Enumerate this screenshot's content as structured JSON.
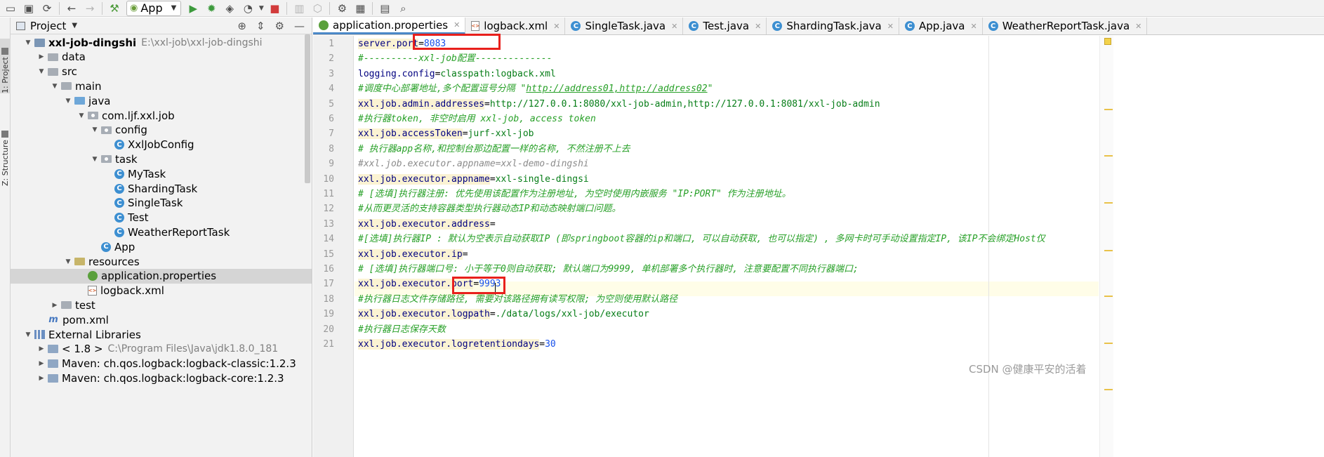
{
  "toolbar": {
    "run_config": "App"
  },
  "side_tabs": {
    "project": "1: Project",
    "structure": "Z: Structure"
  },
  "project_panel": {
    "title": "Project"
  },
  "tree": [
    {
      "label": "xxl-job-dingshi",
      "extra": "E:\\xxl-job\\xxl-job-dingshi",
      "depth": 0,
      "arrow": "open",
      "icon": "module"
    },
    {
      "label": "data",
      "depth": 1,
      "arrow": "closed",
      "icon": "folder"
    },
    {
      "label": "src",
      "depth": 1,
      "arrow": "open",
      "icon": "folder"
    },
    {
      "label": "main",
      "depth": 2,
      "arrow": "open",
      "icon": "folder"
    },
    {
      "label": "java",
      "depth": 3,
      "arrow": "open",
      "icon": "folder-blue"
    },
    {
      "label": "com.ljf.xxl.job",
      "depth": 4,
      "arrow": "open",
      "icon": "package"
    },
    {
      "label": "config",
      "depth": 5,
      "arrow": "open",
      "icon": "package"
    },
    {
      "label": "XxlJobConfig",
      "depth": 6,
      "arrow": "none",
      "icon": "class"
    },
    {
      "label": "task",
      "depth": 5,
      "arrow": "open",
      "icon": "package"
    },
    {
      "label": "MyTask",
      "depth": 6,
      "arrow": "none",
      "icon": "class"
    },
    {
      "label": "ShardingTask",
      "depth": 6,
      "arrow": "none",
      "icon": "class"
    },
    {
      "label": "SingleTask",
      "depth": 6,
      "arrow": "none",
      "icon": "class"
    },
    {
      "label": "Test",
      "depth": 6,
      "arrow": "none",
      "icon": "class"
    },
    {
      "label": "WeatherReportTask",
      "depth": 6,
      "arrow": "none",
      "icon": "class"
    },
    {
      "label": "App",
      "depth": 5,
      "arrow": "none",
      "icon": "class"
    },
    {
      "label": "resources",
      "depth": 3,
      "arrow": "open",
      "icon": "folder-res"
    },
    {
      "label": "application.properties",
      "depth": 4,
      "arrow": "none",
      "icon": "props",
      "selected": true
    },
    {
      "label": "logback.xml",
      "depth": 4,
      "arrow": "none",
      "icon": "xml"
    },
    {
      "label": "test",
      "depth": 2,
      "arrow": "closed",
      "icon": "folder"
    },
    {
      "label": "pom.xml",
      "depth": 1,
      "arrow": "none",
      "icon": "maven"
    },
    {
      "label": "External Libraries",
      "depth": 0,
      "arrow": "open",
      "icon": "lib"
    },
    {
      "label": "< 1.8 >",
      "extra": "C:\\Program Files\\Java\\jdk1.8.0_181",
      "depth": 1,
      "arrow": "closed",
      "icon": "jdk"
    },
    {
      "label": "Maven: ch.qos.logback:logback-classic:1.2.3",
      "depth": 1,
      "arrow": "closed",
      "icon": "jdk"
    },
    {
      "label": "Maven: ch.qos.logback:logback-core:1.2.3",
      "depth": 1,
      "arrow": "closed",
      "icon": "jdk"
    }
  ],
  "tabs": [
    {
      "label": "application.properties",
      "icon": "props",
      "active": true
    },
    {
      "label": "logback.xml",
      "icon": "xml"
    },
    {
      "label": "SingleTask.java",
      "icon": "class"
    },
    {
      "label": "Test.java",
      "icon": "class"
    },
    {
      "label": "ShardingTask.java",
      "icon": "class"
    },
    {
      "label": "App.java",
      "icon": "class"
    },
    {
      "label": "WeatherReportTask.java",
      "icon": "class"
    }
  ],
  "code_lines": [
    {
      "key": "server.port",
      "value": "8083",
      "value_type": "num"
    },
    {
      "comment": "#----------xxl-job配置--------------"
    },
    {
      "key": "logging.config",
      "value": "classpath:logback.xml",
      "plain_key": true
    },
    {
      "comment": "#调度中心部署地址,多个配置逗号分隔 \"http://address01,http://address02\""
    },
    {
      "key": "xxl.job.admin.addresses",
      "value": "http://127.0.0.1:8080/xxl-job-admin,http://127.0.0.1:8081/xxl-job-admin"
    },
    {
      "comment": "#执行器token, 非空时启用 xxl-job, access token"
    },
    {
      "key": "xxl.job.accessToken",
      "value": "jurf-xxl-job"
    },
    {
      "comment": "# 执行器app名称,和控制台那边配置一样的名称, 不然注册不上去"
    },
    {
      "comment": "#xxl.job.executor.appname=xxl-demo-dingshi"
    },
    {
      "key": "xxl.job.executor.appname",
      "value": "xxl-single-dingsi"
    },
    {
      "comment": "# [选填]执行器注册: 优先使用该配置作为注册地址, 为空时使用内嵌服务 \"IP:PORT\" 作为注册地址。"
    },
    {
      "comment": "#从而更灵活的支持容器类型执行器动态IP和动态映射端口问题。"
    },
    {
      "key": "xxl.job.executor.address",
      "value": ""
    },
    {
      "comment": "#[选填]执行器IP : 默认为空表示自动获取IP (即springboot容器的ip和端口, 可以自动获取, 也可以指定) , 多网卡时可手动设置指定IP, 该IP不会绑定Host仅"
    },
    {
      "key": "xxl.job.executor.ip",
      "value": ""
    },
    {
      "comment": "# [选填]执行器端口号: 小于等于0则自动获取; 默认端口为9999, 单机部署多个执行器时, 注意要配置不同执行器端口;"
    },
    {
      "key": "xxl.job.executor.port",
      "value": "9993",
      "value_type": "num"
    },
    {
      "comment": "#执行器日志文件存储路径, 需要对该路径拥有读写权限; 为空则使用默认路径"
    },
    {
      "key": "xxl.job.executor.logpath",
      "value": "./data/logs/xxl-job/executor"
    },
    {
      "comment": "#执行器日志保存天数"
    },
    {
      "key": "xxl.job.executor.logretentiondays",
      "value": "30",
      "value_type": "num"
    }
  ],
  "watermark": "CSDN @健康平安的活着"
}
